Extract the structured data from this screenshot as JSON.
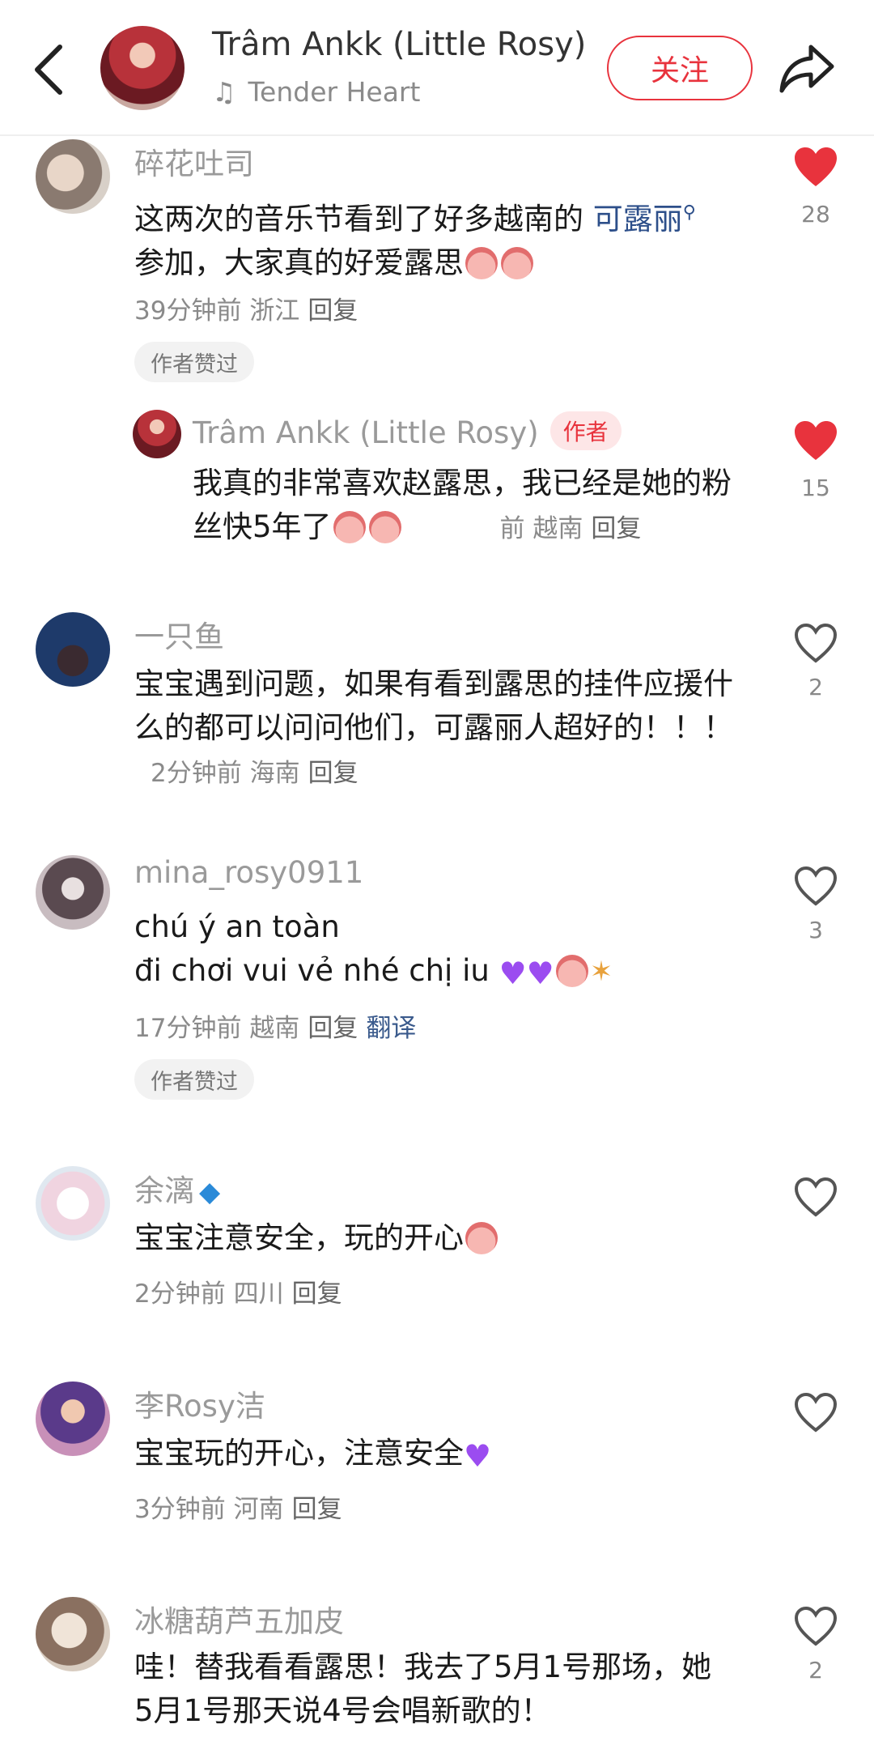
{
  "header": {
    "title": "Trâm Ankk (Little Rosy)",
    "song": "Tender Heart",
    "follow_label": "关注"
  },
  "colors": {
    "accent": "#e8333d",
    "like": "#e8333d",
    "link": "#2d4f8a"
  },
  "comments": [
    {
      "user": "碎花吐司",
      "text_before": "这两次的音乐节看到了好多越南的 ",
      "link": "可露丽",
      "text_after": "参加，大家真的好爱露思",
      "time": "39分钟前",
      "location": "浙江",
      "reply": "回复",
      "badge": "作者赞过",
      "likes": "28",
      "liked": true
    },
    {
      "user": "Trâm Ankk (Little Rosy)",
      "author_tag": "作者",
      "text": "我真的非常喜欢赵露思，我已经是她的粉丝快5年了",
      "time": "前",
      "location": "越南",
      "reply": "回复",
      "likes": "15",
      "liked": true
    },
    {
      "user": "一只鱼",
      "text": "宝宝遇到问题，如果有看到露思的挂件应援什么的都可以问问他们，可露丽人超好的！！！",
      "time": "2分钟前",
      "location": "海南",
      "reply": "回复",
      "likes": "2",
      "liked": false
    },
    {
      "user": "mina_rosy0911",
      "line1": "chú ý an toàn",
      "line2": "đi chơi vui vẻ nhé chị iu",
      "time": "17分钟前",
      "location": "越南",
      "reply": "回复",
      "translate": "翻译",
      "badge": "作者赞过",
      "likes": "3",
      "liked": false
    },
    {
      "user": "余漓",
      "text": "宝宝注意安全，玩的开心",
      "time": "2分钟前",
      "location": "四川",
      "reply": "回复",
      "likes": "",
      "liked": false
    },
    {
      "user": "李Rosy洁",
      "text": "宝宝玩的开心，注意安全",
      "time": "3分钟前",
      "location": "河南",
      "reply": "回复",
      "likes": "",
      "liked": false
    },
    {
      "user": "冰糖葫芦五加皮",
      "text": "哇！替我看看露思！我去了5月1号那场，她5月1号那天说4号会唱新歌的！",
      "likes": "2",
      "liked": false
    }
  ]
}
